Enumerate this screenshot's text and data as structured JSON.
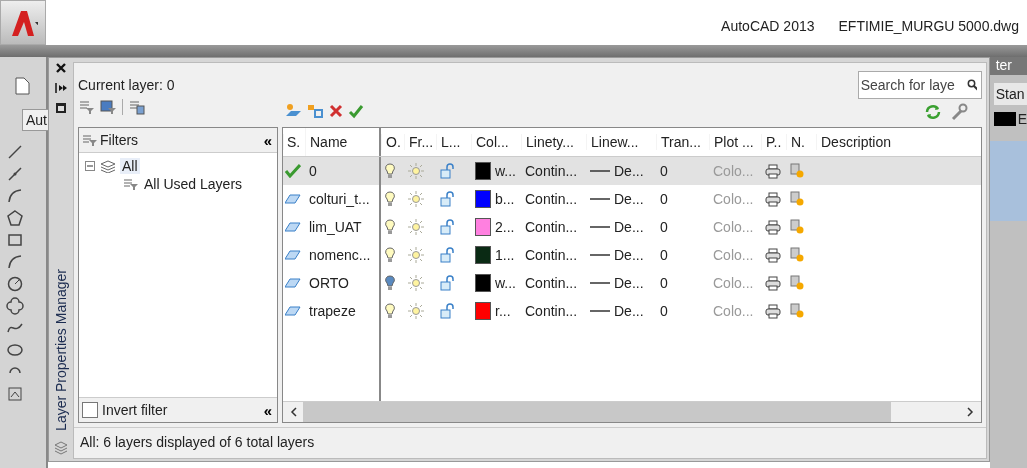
{
  "app": {
    "title": "AutoCAD 2013",
    "file": "EFTIMIE_MURGU 5000.dwg"
  },
  "background": {
    "tab_label": "Aut",
    "right_texts": [
      "ter",
      "Stan",
      "E"
    ]
  },
  "palette": {
    "title": "Layer Properties Manager",
    "current_layer": "Current layer: 0",
    "search": {
      "placeholder": "Search for laye"
    },
    "filters": {
      "header": "Filters",
      "collapse_glyph": "«",
      "tree": [
        {
          "label": "All",
          "selected": true,
          "expanded": true,
          "children": [
            {
              "label": "All Used Layers",
              "selected": false
            }
          ]
        }
      ],
      "invert_filter": {
        "label": "Invert filter",
        "checked": false,
        "collapse_glyph": "«"
      }
    },
    "columns": [
      "S.",
      "Name",
      "O.",
      "Fr...",
      "L...",
      "Col...",
      "Linety...",
      "Linew...",
      "Tran...",
      "Plot ...",
      "P..",
      "N.",
      "Description"
    ],
    "layers": [
      {
        "name": "0",
        "current": true,
        "selected": true,
        "on": true,
        "color": "#000000",
        "color_name": "w...",
        "linetype": "Contin...",
        "lineweight": "De...",
        "transparency": "0",
        "plot_style": "Colo..."
      },
      {
        "name": "colturi_t...",
        "current": false,
        "selected": false,
        "on": true,
        "color": "#0000ff",
        "color_name": "b...",
        "linetype": "Contin...",
        "lineweight": "De...",
        "transparency": "0",
        "plot_style": "Colo..."
      },
      {
        "name": "lim_UAT",
        "current": false,
        "selected": false,
        "on": true,
        "color": "#ff80e0",
        "color_name": "2...",
        "linetype": "Contin...",
        "lineweight": "De...",
        "transparency": "0",
        "plot_style": "Colo..."
      },
      {
        "name": "nomenc...",
        "current": false,
        "selected": false,
        "on": true,
        "color": "#0a2a14",
        "color_name": "1...",
        "linetype": "Contin...",
        "lineweight": "De...",
        "transparency": "0",
        "plot_style": "Colo..."
      },
      {
        "name": "ORTO",
        "current": false,
        "selected": false,
        "on": false,
        "color": "#000000",
        "color_name": "w...",
        "linetype": "Contin...",
        "lineweight": "De...",
        "transparency": "0",
        "plot_style": "Colo..."
      },
      {
        "name": "trapeze",
        "current": false,
        "selected": false,
        "on": true,
        "color": "#ff0000",
        "color_name": "r...",
        "linetype": "Contin...",
        "lineweight": "De...",
        "transparency": "0",
        "plot_style": "Colo..."
      }
    ],
    "status": "All: 6 layers displayed of 6 total layers"
  }
}
